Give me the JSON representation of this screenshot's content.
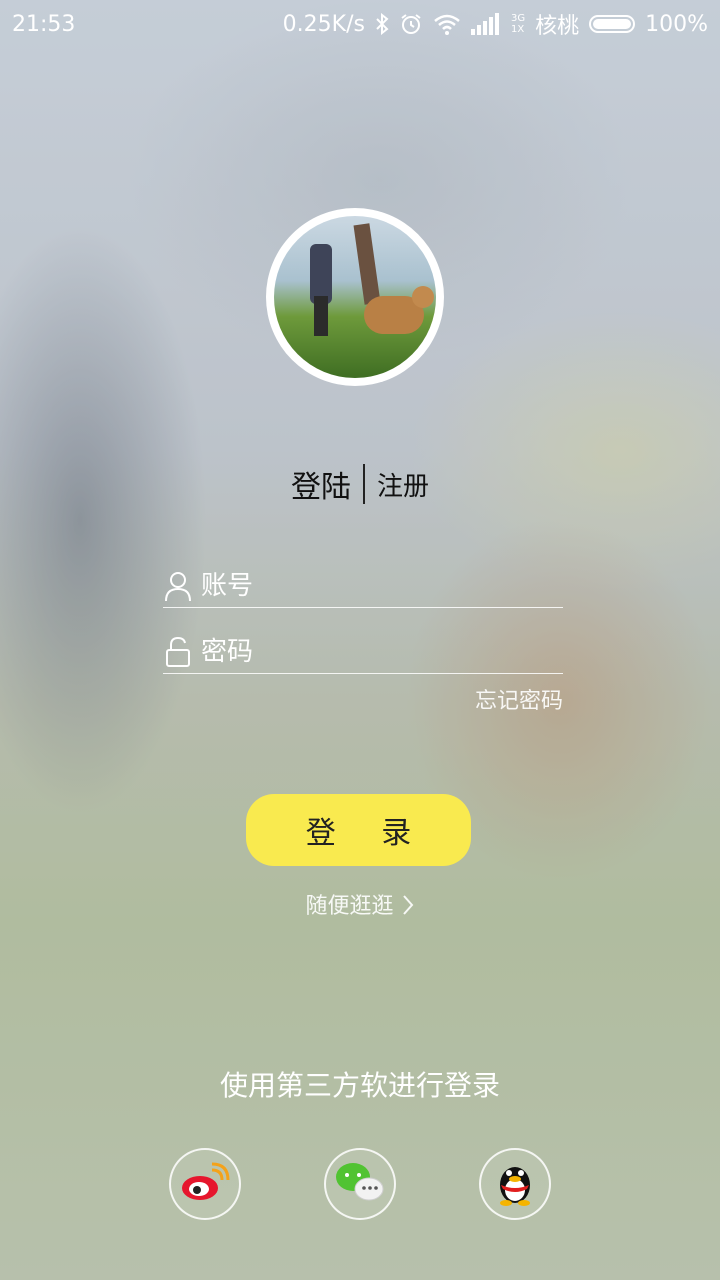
{
  "status_bar": {
    "time": "21:53",
    "speed": "0.25K/s",
    "network_top": "3G",
    "network_bottom": "1X",
    "carrier": "核桃",
    "battery_level": 1.0,
    "battery_text": "100%",
    "icons": [
      "bluetooth-icon",
      "alarm-icon",
      "wifi-icon",
      "signal-icon",
      "battery-icon"
    ]
  },
  "avatar": {
    "description_icon": "user-avatar"
  },
  "tabs": {
    "login": "登陆",
    "register": "注册"
  },
  "form": {
    "account_placeholder": "账号",
    "account_value": "",
    "password_placeholder": "密码",
    "password_value": "",
    "forgot_label": "忘记密码"
  },
  "login_button": "登 录",
  "browse_label": "随便逛逛",
  "third_party": {
    "title": "使用第三方软进行登录",
    "providers": [
      "weibo-icon",
      "wechat-icon",
      "qq-icon"
    ]
  },
  "colors": {
    "accent": "#f9ea4f",
    "text_dark": "#111111"
  }
}
